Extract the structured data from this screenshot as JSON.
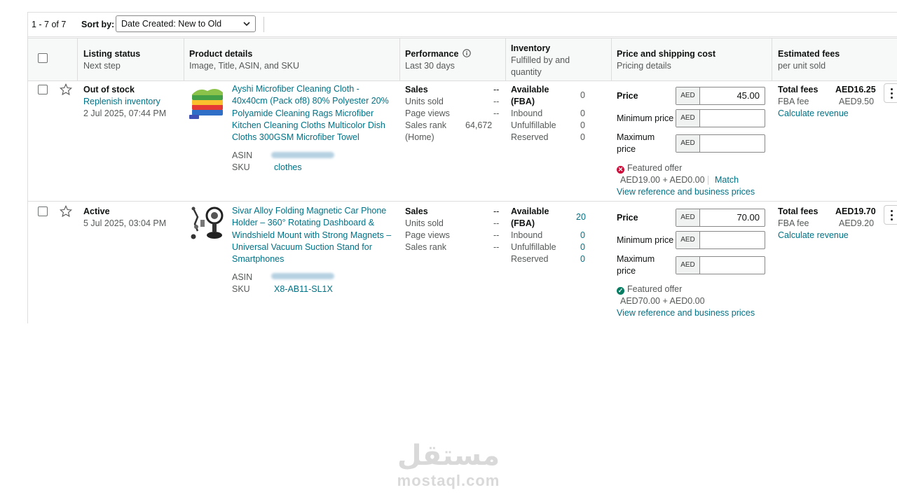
{
  "toolbar": {
    "count": "1 - 7 of 7",
    "sort_label": "Sort by:",
    "sort_value": "Date Created: New to Old"
  },
  "columns": {
    "status": {
      "title": "Listing status",
      "sub": "Next step"
    },
    "product": {
      "title": "Product details",
      "sub": "Image, Title, ASIN, and SKU"
    },
    "performance": {
      "title": "Performance",
      "sub": "Last 30 days"
    },
    "inventory": {
      "title": "Inventory",
      "sub1": "Fulfilled by and",
      "sub2": "quantity"
    },
    "price": {
      "title": "Price and shipping cost",
      "sub": "Pricing details"
    },
    "fees": {
      "title": "Estimated fees",
      "sub": "per unit sold"
    }
  },
  "rows": [
    {
      "status": "Out of stock",
      "next_step": "Replenish inventory",
      "date": "2 Jul 2025, 07:44 PM",
      "title": "Ayshi Microfiber Cleaning Cloth - 40x40cm (Pack of8) 80% Polyester 20% Polyamide Cleaning Rags Microfiber Kitchen Cleaning Cloths Multicolor Dish Cloths 300GSM Microfiber Towel",
      "asin_label": "ASIN",
      "sku_label": "SKU",
      "sku": "clothes",
      "perf": {
        "sales_label": "Sales",
        "sales": "--",
        "units_label": "Units sold",
        "units": "--",
        "views_label": "Page views",
        "views": "--",
        "rank_label": "Sales rank",
        "rank": "64,672",
        "rank_cat": "(Home)"
      },
      "inv": {
        "available_label": "Available",
        "fba_label": "(FBA)",
        "available": "0",
        "inbound_label": "Inbound",
        "inbound": "0",
        "unful_label": "Unfulfillable",
        "unful": "0",
        "reserved_label": "Reserved",
        "reserved": "0"
      },
      "price": {
        "price_label": "Price",
        "currency": "AED",
        "price": "45.00",
        "min_label": "Minimum price",
        "max_label1": "Maximum",
        "max_label2": "price",
        "offer": "Featured offer",
        "offer_status": "error",
        "offer_price": "AED19.00 + AED0.00",
        "match": "Match",
        "ref_link": "View reference and business prices"
      },
      "fees": {
        "total_label": "Total fees",
        "total": "AED16.25",
        "fba_label": "FBA fee",
        "fba": "AED9.50",
        "calc": "Calculate revenue"
      }
    },
    {
      "status": "Active",
      "date": "5 Jul 2025, 03:04 PM",
      "title": "Sivar Alloy Folding Magnetic Car Phone Holder – 360° Rotating Dashboard & Windshield Mount with Strong Magnets – Universal Vacuum Suction Stand for Smartphones",
      "asin_label": "ASIN",
      "sku_label": "SKU",
      "sku": "X8-AB11-SL1X",
      "perf": {
        "sales_label": "Sales",
        "sales": "--",
        "units_label": "Units sold",
        "units": "--",
        "views_label": "Page views",
        "views": "--",
        "rank_label": "Sales rank",
        "rank": "--"
      },
      "inv": {
        "available_label": "Available",
        "fba_label": "(FBA)",
        "available": "20",
        "inbound_label": "Inbound",
        "inbound": "0",
        "unful_label": "Unfulfillable",
        "unful": "0",
        "reserved_label": "Reserved",
        "reserved": "0"
      },
      "price": {
        "price_label": "Price",
        "currency": "AED",
        "price": "70.00",
        "min_label": "Minimum price",
        "max_label1": "Maximum",
        "max_label2": "price",
        "offer": "Featured offer",
        "offer_status": "ok",
        "offer_price": "AED70.00 + AED0.00",
        "ref_link": "View reference and business prices"
      },
      "fees": {
        "total_label": "Total fees",
        "total": "AED19.70",
        "fba_label": "FBA fee",
        "fba": "AED9.20",
        "calc": "Calculate revenue"
      }
    }
  ],
  "watermark": {
    "arabic": "مستقل",
    "latin": "mostaql.com"
  },
  "colors": {
    "link": "#007185",
    "error": "#cc0c39",
    "success": "#067d62"
  }
}
